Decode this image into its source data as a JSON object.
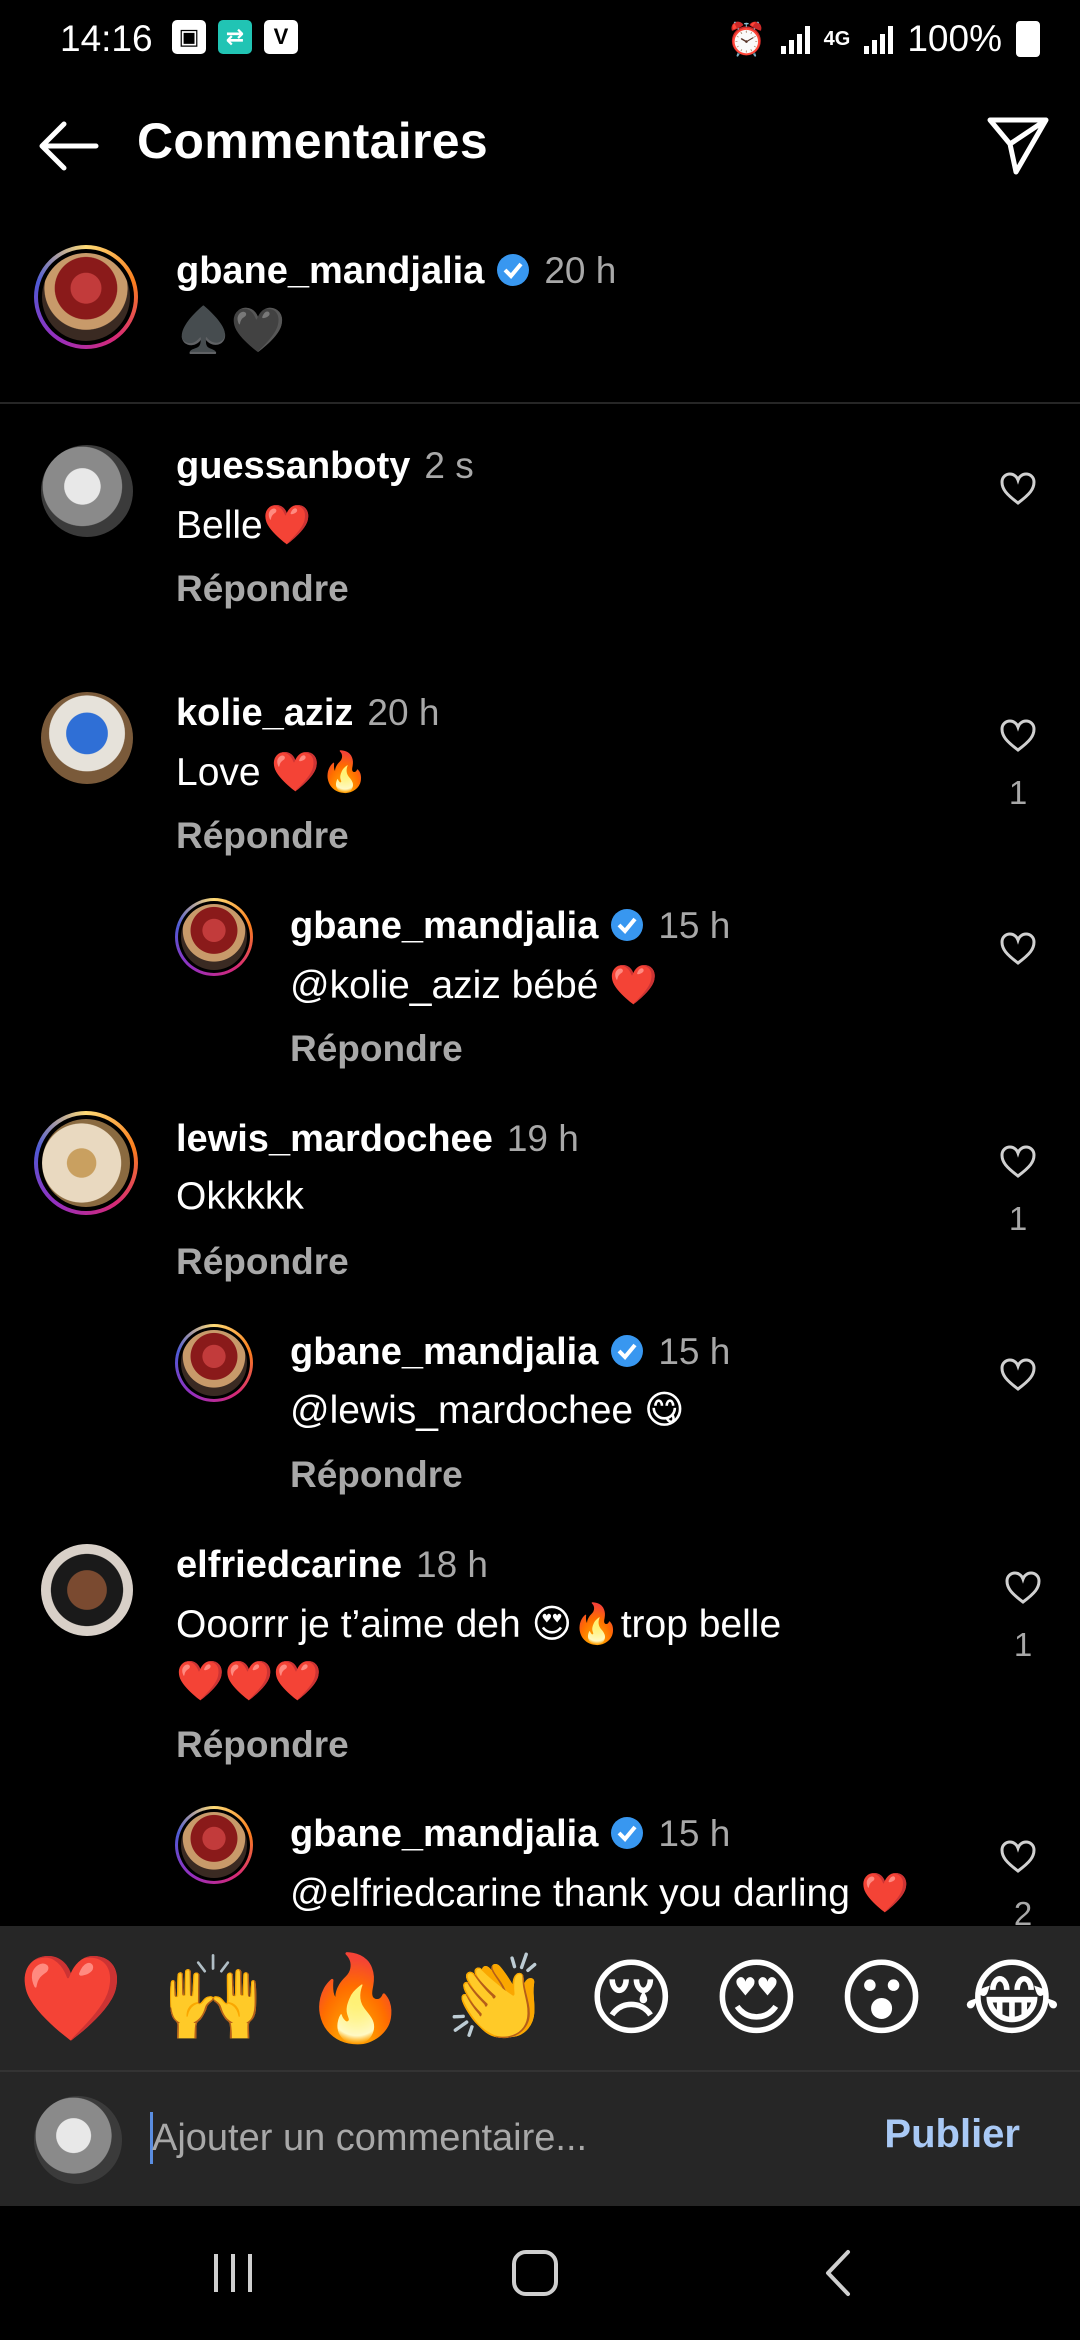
{
  "status_bar": {
    "time": "14:16",
    "network": "4G",
    "battery": "100%"
  },
  "header": {
    "title": "Commentaires"
  },
  "post": {
    "username": "gbane_mandjalia",
    "time": "20 h",
    "caption": "♠️🖤"
  },
  "comments": [
    {
      "username": "guessanboty",
      "time": "2 s",
      "text": "Belle❤️",
      "reply": "Répondre",
      "likes": ""
    },
    {
      "username": "kolie_aziz",
      "time": "20 h",
      "text": "Love ❤️🔥",
      "reply": "Répondre",
      "likes": "1",
      "replies": [
        {
          "username": "gbane_mandjalia",
          "time": "15 h",
          "text": "@kolie_aziz bébé ❤️",
          "reply": "Répondre",
          "likes": ""
        }
      ]
    },
    {
      "username": "lewis_mardochee",
      "time": "19 h",
      "text": "Okkkkk",
      "reply": "Répondre",
      "likes": "1",
      "replies": [
        {
          "username": "gbane_mandjalia",
          "time": "15 h",
          "text": "@lewis_mardochee 😋",
          "reply": "Répondre",
          "likes": ""
        }
      ]
    },
    {
      "username": "elfriedcarine",
      "time": "18 h",
      "text": "Ooorrr je t’aime deh 😍🔥trop belle",
      "text2": "❤️❤️❤️",
      "reply": "Répondre",
      "likes": "1",
      "replies": [
        {
          "username": "gbane_mandjalia",
          "time": "15 h",
          "text": "@elfriedcarine thank you darling ❤️",
          "likes": "2"
        }
      ]
    }
  ],
  "emoji_bar": [
    "❤️",
    "🙌",
    "🔥",
    "👏",
    "😢",
    "😍",
    "😮",
    "😂"
  ],
  "composer": {
    "placeholder": "Ajouter un commentaire...",
    "publish_label": "Publier"
  },
  "icons": {
    "verified_color": "#3897f0",
    "like": "heart-outline-icon",
    "send": "paper-plane-icon",
    "back": "arrow-left-icon"
  }
}
